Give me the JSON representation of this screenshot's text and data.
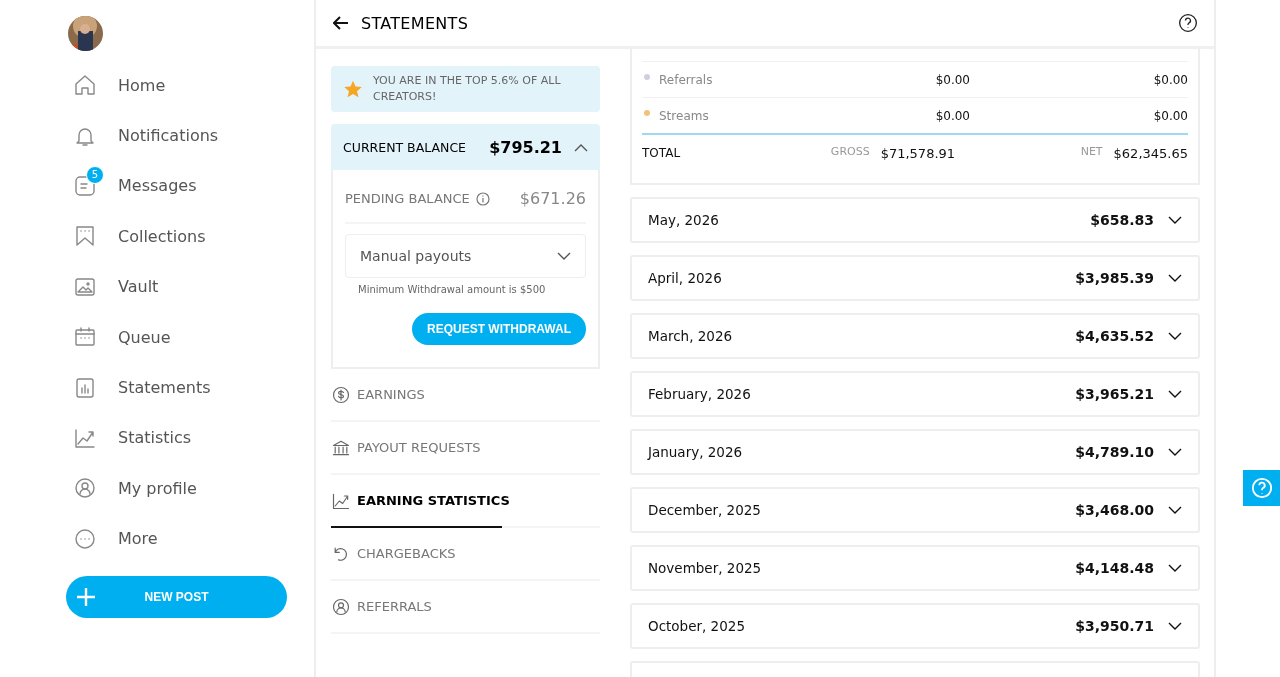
{
  "sidebar": {
    "items": [
      {
        "label": "Home"
      },
      {
        "label": "Notifications"
      },
      {
        "label": "Messages",
        "badge": "5"
      },
      {
        "label": "Collections"
      },
      {
        "label": "Vault"
      },
      {
        "label": "Queue"
      },
      {
        "label": "Statements"
      },
      {
        "label": "Statistics"
      },
      {
        "label": "My profile"
      },
      {
        "label": "More"
      }
    ],
    "new_post": {
      "label": "NEW POST"
    }
  },
  "header": {
    "title": "STATEMENTS"
  },
  "rank_notice": "YOU ARE IN THE TOP 5.6% OF ALL CREATORS!",
  "balance": {
    "label": "CURRENT BALANCE",
    "amount": "$795.21",
    "expanded": true,
    "pending_label": "PENDING BALANCE",
    "pending_amount": "$671.26",
    "payout_mode": "Manual payouts",
    "hint": "Minimum Withdrawal amount is $500",
    "button": "REQUEST WITHDRAWAL"
  },
  "sections": [
    {
      "label": "EARNINGS",
      "selected": false
    },
    {
      "label": "PAYOUT REQUESTS",
      "selected": false
    },
    {
      "label": "EARNING STATISTICS",
      "selected": true
    },
    {
      "label": "CHARGEBACKS",
      "selected": false
    },
    {
      "label": "REFERRALS",
      "selected": false
    }
  ],
  "summary": {
    "rows": [
      {
        "label": "Referrals",
        "color": "#d3cde0",
        "values": [
          "$0.00",
          "$0.00"
        ]
      },
      {
        "label": "Streams",
        "color": "#f2c27a",
        "values": [
          "$0.00",
          "$0.00"
        ]
      }
    ],
    "total": {
      "label": "TOTAL",
      "gross_label": "GROSS",
      "gross": "$71,578.91",
      "net_label": "NET",
      "net": "$62,345.65"
    }
  },
  "months": [
    {
      "label": "May, 2026",
      "amount": "$658.83"
    },
    {
      "label": "April, 2026",
      "amount": "$3,985.39"
    },
    {
      "label": "March, 2026",
      "amount": "$4,635.52"
    },
    {
      "label": "February, 2026",
      "amount": "$3,965.21"
    },
    {
      "label": "January, 2026",
      "amount": "$4,789.10"
    },
    {
      "label": "December, 2025",
      "amount": "$3,468.00"
    },
    {
      "label": "November, 2025",
      "amount": "$4,148.48"
    },
    {
      "label": "October, 2025",
      "amount": "$3,950.71"
    }
  ],
  "more_months_below": true
}
